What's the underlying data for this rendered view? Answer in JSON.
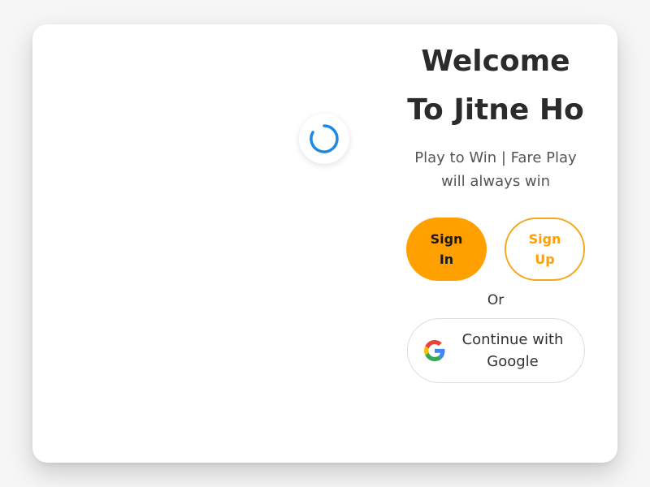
{
  "hero": {
    "title": "Welcome To Jitne Ho",
    "subtitle": "Play to Win | Fare Play will always win"
  },
  "actions": {
    "sign_in_label": "Sign In",
    "sign_up_label": "Sign Up",
    "or_label": "Or",
    "google_label": "Continue with Google"
  },
  "icons": {
    "loader": "loading-spinner-icon",
    "google": "google-icon"
  },
  "colors": {
    "primary": "#ffa000",
    "outline": "#f2a91e",
    "spinner": "#1e88e5"
  }
}
